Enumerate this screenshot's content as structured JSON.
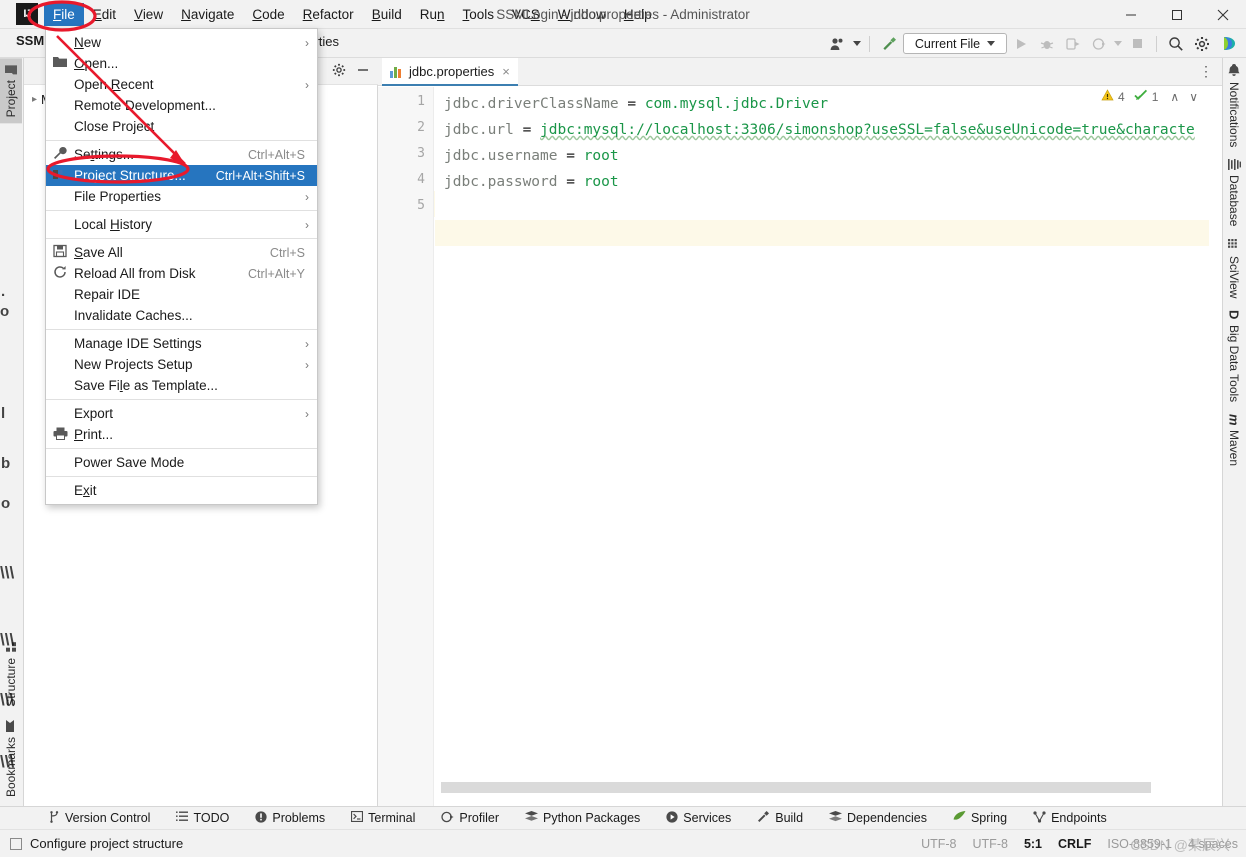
{
  "window": {
    "title": "SSMLogin - jdbc.properties - Administrator",
    "logo": "IJ",
    "controls": [
      "minimize-icon",
      "maximize-icon",
      "close-icon"
    ]
  },
  "menubar": {
    "items": [
      {
        "label": "File",
        "mnemonic": "F",
        "selected": true
      },
      {
        "label": "Edit",
        "mnemonic": "E",
        "selected": false
      },
      {
        "label": "View",
        "mnemonic": "V",
        "selected": false
      },
      {
        "label": "Navigate",
        "mnemonic": "N",
        "selected": false
      },
      {
        "label": "Code",
        "mnemonic": "C",
        "selected": false
      },
      {
        "label": "Refactor",
        "mnemonic": "R",
        "selected": false
      },
      {
        "label": "Build",
        "mnemonic": "B",
        "selected": false
      },
      {
        "label": "Run",
        "mnemonic": "n",
        "selected": false
      },
      {
        "label": "Tools",
        "mnemonic": "T",
        "selected": false
      },
      {
        "label": "VCS",
        "mnemonic": "S",
        "selected": false
      },
      {
        "label": "Window",
        "mnemonic": "W",
        "selected": false
      },
      {
        "label": "Help",
        "mnemonic": "H",
        "selected": false
      }
    ]
  },
  "file_menu": {
    "groups": [
      [
        {
          "label": "New",
          "mnemonic": "N",
          "icon": "",
          "shortcut": "",
          "submenu": true,
          "selected": false
        },
        {
          "label": "Open...",
          "mnemonic": "O",
          "icon": "folder-icon",
          "shortcut": "",
          "submenu": false,
          "selected": false
        },
        {
          "label": "Open Recent",
          "mnemonic": "R",
          "icon": "",
          "shortcut": "",
          "submenu": true,
          "selected": false
        },
        {
          "label": "Remote Development...",
          "mnemonic": "",
          "icon": "",
          "shortcut": "",
          "submenu": false,
          "selected": false
        },
        {
          "label": "Close Project",
          "mnemonic": "",
          "icon": "",
          "shortcut": "",
          "submenu": false,
          "selected": false
        }
      ],
      [
        {
          "label": "Settings...",
          "mnemonic": "t",
          "icon": "wrench-icon",
          "shortcut": "Ctrl+Alt+S",
          "submenu": false,
          "selected": false
        },
        {
          "label": "Project Structure...",
          "mnemonic": "",
          "icon": "project-structure-icon",
          "shortcut": "Ctrl+Alt+Shift+S",
          "submenu": false,
          "selected": true
        },
        {
          "label": "File Properties",
          "mnemonic": "",
          "icon": "",
          "shortcut": "",
          "submenu": true,
          "selected": false
        }
      ],
      [
        {
          "label": "Local History",
          "mnemonic": "H",
          "icon": "",
          "shortcut": "",
          "submenu": true,
          "selected": false
        }
      ],
      [
        {
          "label": "Save All",
          "mnemonic": "S",
          "icon": "save-icon",
          "shortcut": "Ctrl+S",
          "submenu": false,
          "selected": false
        },
        {
          "label": "Reload All from Disk",
          "mnemonic": "",
          "icon": "reload-icon",
          "shortcut": "Ctrl+Alt+Y",
          "submenu": false,
          "selected": false
        },
        {
          "label": "Repair IDE",
          "mnemonic": "",
          "icon": "",
          "shortcut": "",
          "submenu": false,
          "selected": false
        },
        {
          "label": "Invalidate Caches...",
          "mnemonic": "",
          "icon": "",
          "shortcut": "",
          "submenu": false,
          "selected": false
        }
      ],
      [
        {
          "label": "Manage IDE Settings",
          "mnemonic": "",
          "icon": "",
          "shortcut": "",
          "submenu": true,
          "selected": false
        },
        {
          "label": "New Projects Setup",
          "mnemonic": "",
          "icon": "",
          "shortcut": "",
          "submenu": true,
          "selected": false
        },
        {
          "label": "Save File as Template...",
          "mnemonic": "l",
          "icon": "",
          "shortcut": "",
          "submenu": false,
          "selected": false
        }
      ],
      [
        {
          "label": "Export",
          "mnemonic": "",
          "icon": "",
          "shortcut": "",
          "submenu": true,
          "selected": false
        },
        {
          "label": "Print...",
          "mnemonic": "P",
          "icon": "print-icon",
          "shortcut": "",
          "submenu": false,
          "selected": false
        }
      ],
      [
        {
          "label": "Power Save Mode",
          "mnemonic": "",
          "icon": "",
          "shortcut": "",
          "submenu": false,
          "selected": false
        }
      ],
      [
        {
          "label": "Exit",
          "mnemonic": "x",
          "icon": "",
          "shortcut": "",
          "submenu": false,
          "selected": false
        }
      ]
    ]
  },
  "toolbar": {
    "breadcrumb_project": "SSM",
    "breadcrumb_file": "perties",
    "run_config": "Current File",
    "icons": [
      "user-icon",
      "chevron-down-icon",
      "hammer-icon",
      "run-icon",
      "debug-icon",
      "run-coverage-icon",
      "profile-icon",
      "stop-icon",
      "search-icon",
      "gear-icon",
      "ai-assistant-icon"
    ]
  },
  "left_stripe": {
    "top": [
      {
        "label": "Project",
        "icon": "project-folder-icon",
        "active": true
      }
    ],
    "bottom": [
      {
        "label": "Structure",
        "icon": "structure-icon",
        "active": false
      },
      {
        "label": "Bookmarks",
        "icon": "bookmark-icon",
        "active": false
      }
    ]
  },
  "right_stripe": {
    "items": [
      {
        "label": "Notifications",
        "icon": "bell-icon"
      },
      {
        "label": "Database",
        "icon": "database-icon"
      },
      {
        "label": "SciView",
        "icon": "sciview-icon"
      },
      {
        "label": "Big Data Tools",
        "icon": "big-data-tools-icon"
      },
      {
        "label": "Maven",
        "icon": "maven-icon"
      }
    ]
  },
  "project_panel": {
    "root_label": "MLogin",
    "header_icons": [
      "gear-icon",
      "minimize-icon"
    ]
  },
  "editor": {
    "tab": {
      "label": "jdbc.properties",
      "icon": "properties-file-icon",
      "close": "×"
    },
    "tab_options": "⋮",
    "inspections": {
      "warning_count": "4",
      "warning_icon": "warning-triangle-icon",
      "ok_count": "1",
      "ok_icon": "inspection-ok-icon",
      "prev": "∧",
      "next": "∨"
    },
    "line_numbers": [
      "1",
      "2",
      "3",
      "4",
      "5"
    ],
    "lines": [
      {
        "key": "jdbc.driverClassName",
        "eq": " = ",
        "value": "com.mysql.jdbc.Driver",
        "squiggle": false
      },
      {
        "key": "jdbc.url",
        "eq": " = ",
        "value": "jdbc:mysql://localhost:3306/simonshop?useSSL=false&useUnicode=true&characte",
        "squiggle": true
      },
      {
        "key": "jdbc.username",
        "eq": " = ",
        "value": "root",
        "squiggle": false
      },
      {
        "key": "jdbc.password",
        "eq": " = ",
        "value": "root",
        "squiggle": false
      },
      {
        "key": "",
        "eq": "",
        "value": "",
        "squiggle": false
      }
    ]
  },
  "bottom_bar": {
    "items": [
      {
        "label": "Version Control",
        "icon": "branch-icon"
      },
      {
        "label": "TODO",
        "icon": "todo-list-icon"
      },
      {
        "label": "Problems",
        "icon": "problems-icon"
      },
      {
        "label": "Terminal",
        "icon": "terminal-icon"
      },
      {
        "label": "Profiler",
        "icon": "profiler-icon"
      },
      {
        "label": "Python Packages",
        "icon": "packages-icon"
      },
      {
        "label": "Services",
        "icon": "services-icon"
      },
      {
        "label": "Build",
        "icon": "build-hammer-icon"
      },
      {
        "label": "Dependencies",
        "icon": "dependencies-icon"
      },
      {
        "label": "Spring",
        "icon": "spring-leaf-icon"
      },
      {
        "label": "Endpoints",
        "icon": "endpoints-icon"
      }
    ]
  },
  "status_bar": {
    "message": "Configure project structure",
    "message_icon": "inspection-widget-icon",
    "encoding_project": "UTF-8",
    "encoding_file": "UTF-8",
    "caret_position": "5:1",
    "line_separator": "CRLF",
    "file_encoding": "ISO-8859-1",
    "indent": "4 spaces",
    "watermark": "CSDN @某辰兴"
  },
  "annotations": {
    "highlight_color": "#e8192c",
    "shapes": [
      "ellipse-around-file-menu",
      "arrow-to-project-structure",
      "ellipse-around-project-structure"
    ]
  }
}
